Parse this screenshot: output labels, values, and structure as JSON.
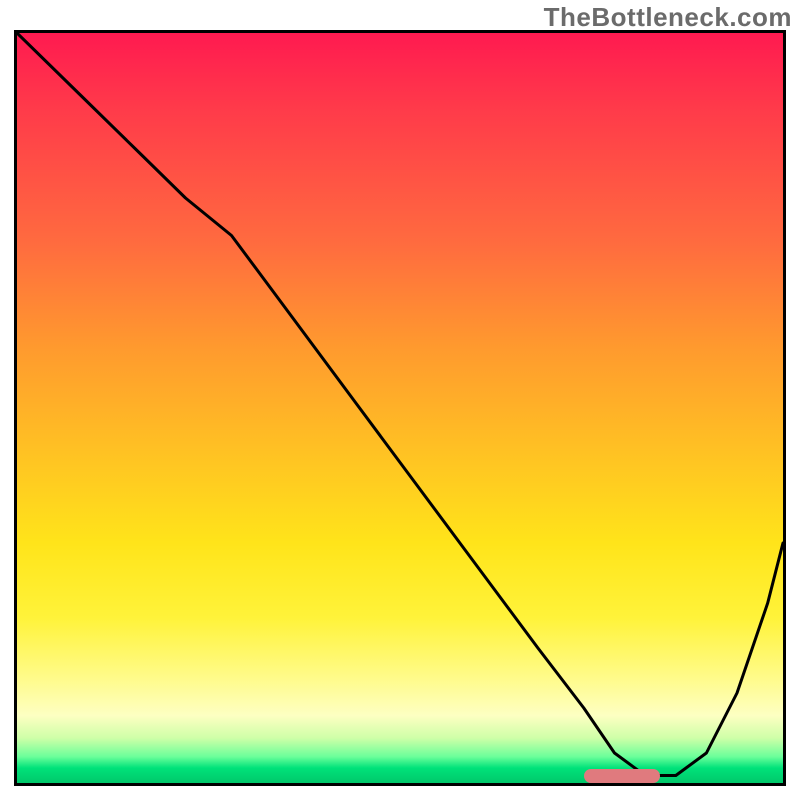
{
  "watermark": "TheBottleneck.com",
  "chart_data": {
    "type": "line",
    "title": "",
    "xlabel": "",
    "ylabel": "",
    "xlim": [
      0,
      100
    ],
    "ylim": [
      0,
      100
    ],
    "series": [
      {
        "name": "curve",
        "x": [
          0,
          8,
          16,
          22,
          28,
          36,
          44,
          52,
          60,
          68,
          74,
          78,
          82,
          86,
          90,
          94,
          98,
          100
        ],
        "y": [
          100,
          92,
          84,
          78,
          73,
          62,
          51,
          40,
          29,
          18,
          10,
          4,
          1,
          1,
          4,
          12,
          24,
          32
        ]
      }
    ],
    "marker": {
      "x_start": 74,
      "x_end": 84,
      "y": 1
    }
  },
  "colors": {
    "curve": "#000000",
    "marker": "#e07a7e",
    "border": "#000000"
  }
}
